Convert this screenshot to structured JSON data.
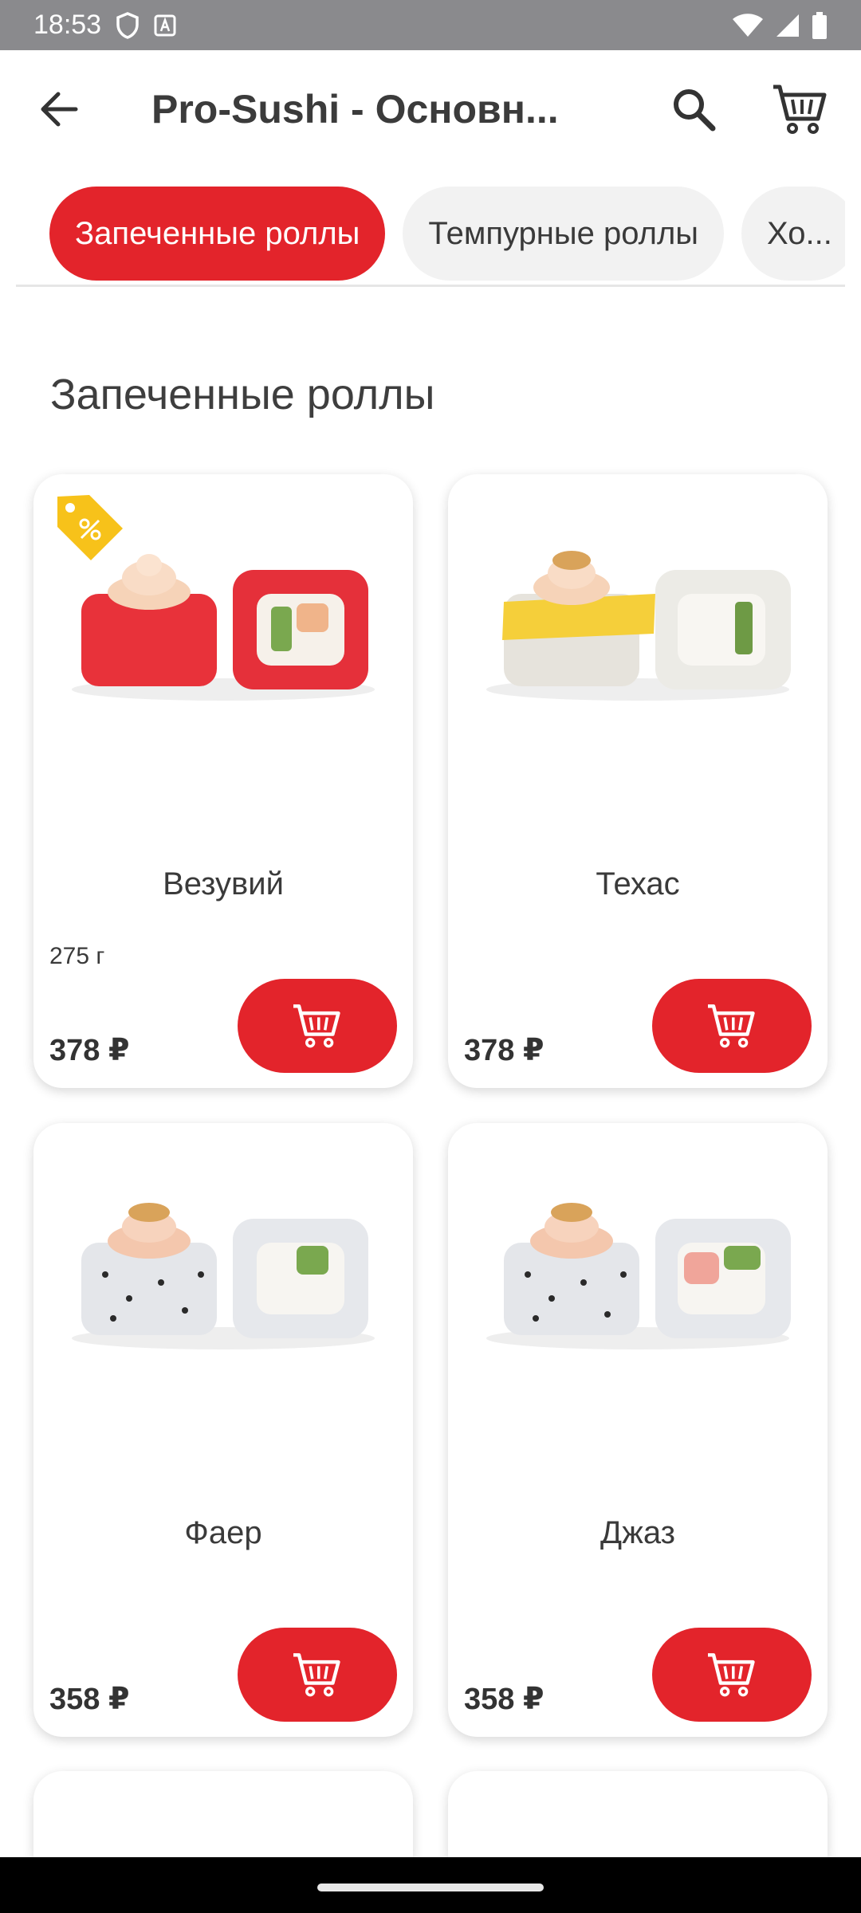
{
  "status_bar": {
    "time": "18:53",
    "icons": [
      "shield-icon",
      "a-box-icon",
      "wifi-icon",
      "signal-icon",
      "battery-icon"
    ]
  },
  "app_bar": {
    "title": "Pro-Sushi - Основн...",
    "icons": [
      "arrow-left-icon",
      "search-icon",
      "cart-icon"
    ]
  },
  "categories": [
    {
      "label": "Запеченные роллы",
      "active": true
    },
    {
      "label": "Темпурные роллы",
      "active": false
    },
    {
      "label": "Хо...",
      "active": false
    }
  ],
  "section": {
    "title": "Запеченные роллы"
  },
  "products": [
    {
      "name": "Везувий",
      "weight": "275 г",
      "price": "378 ₽",
      "promo": true,
      "promo_icon": "percent-tag-icon"
    },
    {
      "name": "Техас",
      "weight": "",
      "price": "378 ₽",
      "promo": false
    },
    {
      "name": "Фаер",
      "weight": "",
      "price": "358 ₽",
      "promo": false
    },
    {
      "name": "Джаз",
      "weight": "",
      "price": "358 ₽",
      "promo": false
    }
  ],
  "colors": {
    "accent": "#e3242b",
    "promo_tag": "#f7c21a",
    "chip_bg": "#f2f2f2",
    "status_bar": "#8a8a8d"
  }
}
